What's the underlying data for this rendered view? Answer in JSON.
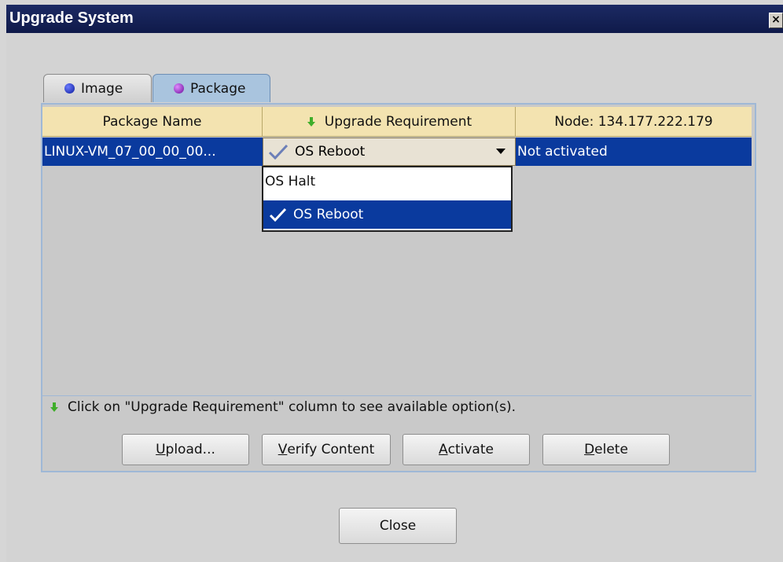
{
  "window": {
    "title": "Upgrade System",
    "close_glyph": "×"
  },
  "tabs": [
    {
      "label": "Image",
      "icon": "blue-dot-icon",
      "active": false
    },
    {
      "label": "Package",
      "icon": "purple-dot-icon",
      "active": true
    }
  ],
  "table": {
    "columns": [
      "Package Name",
      "Upgrade Requirement",
      "Node: 134.177.222.179"
    ],
    "rows": [
      {
        "package_name": "LINUX-VM_07_00_00_00...",
        "upgrade_requirement": "OS Reboot",
        "node_status": "Not activated",
        "selected": true
      }
    ]
  },
  "dropdown": {
    "options": [
      "OS Halt",
      "OS Reboot"
    ],
    "selected": "OS Reboot"
  },
  "hint": "Click on \"Upgrade Requirement\" column to see available option(s).",
  "buttons": {
    "upload_mnemonic": "U",
    "upload_rest": "pload...",
    "verify_mnemonic": "V",
    "verify_rest": "erify Content",
    "activate_mnemonic": "A",
    "activate_rest": "ctivate",
    "delete_mnemonic": "D",
    "delete_rest": "elete",
    "close": "Close"
  },
  "colors": {
    "titlebar": "#0f1a4a",
    "selection": "#0a3a9e",
    "header": "#f3e3b0",
    "active_tab": "#a9c4de"
  }
}
